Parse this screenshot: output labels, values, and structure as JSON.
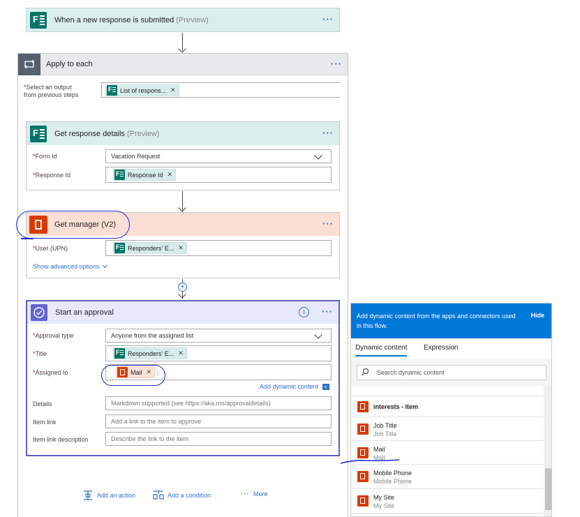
{
  "trigger": {
    "title": "When a new response is submitted",
    "tag": "(Preview)"
  },
  "apply_each": {
    "title": "Apply to each",
    "select_label": "Select an output from previous steps",
    "select_label_line1": "Select an output",
    "select_label_line2": "from previous steps",
    "token": "List of respons..."
  },
  "get_response": {
    "title": "Get response details",
    "tag": "(Preview)",
    "form_id_label": "Form Id",
    "form_id_value": "Vacation Request",
    "response_id_label": "Response Id",
    "response_id_token": "Response Id"
  },
  "get_manager": {
    "title": "Get manager (V2)",
    "user_label": "User (UPN)",
    "user_token": "Responders' E...",
    "advanced": "Show advanced options"
  },
  "approval": {
    "title": "Start an approval",
    "type_label": "Approval type",
    "type_value": "Anyone from the assigned list",
    "title_label": "Title",
    "title_token": "Responders' E...",
    "assigned_label": "Assigned to",
    "assigned_token": "Mail",
    "assigned_suffix": ";",
    "add_dynamic": "Add dynamic content",
    "details_label": "Details",
    "details_placeholder": "Markdown supported (see https://aka.ms/approvaldetails)",
    "item_link_label": "Item link",
    "item_link_placeholder": "Add a link to the item to approve",
    "item_desc_label": "Item link description",
    "item_desc_placeholder": "Describe the link to the item"
  },
  "required_mark": "*",
  "bottom": {
    "add_action": "Add an action",
    "add_condition": "Add a condition",
    "more": "More"
  },
  "panel": {
    "message": "Add dynamic content from the apps and connectors used in this flow.",
    "hide": "Hide",
    "tab_dynamic": "Dynamic content",
    "tab_expression": "Expression",
    "search_placeholder": "Search dynamic content",
    "items": [
      {
        "title": "interests - Item",
        "subtitle": ""
      },
      {
        "title": "Job Title",
        "subtitle": "Job Title"
      },
      {
        "title": "Mail",
        "subtitle": "Mail"
      },
      {
        "title": "Mobile Phone",
        "subtitle": "Mobile Phone"
      },
      {
        "title": "My Site",
        "subtitle": "My Site"
      }
    ]
  },
  "colors": {
    "forms": "#077568",
    "office": "#d83b01",
    "accent": "#0078d7",
    "annotation": "#1d2ad0"
  }
}
